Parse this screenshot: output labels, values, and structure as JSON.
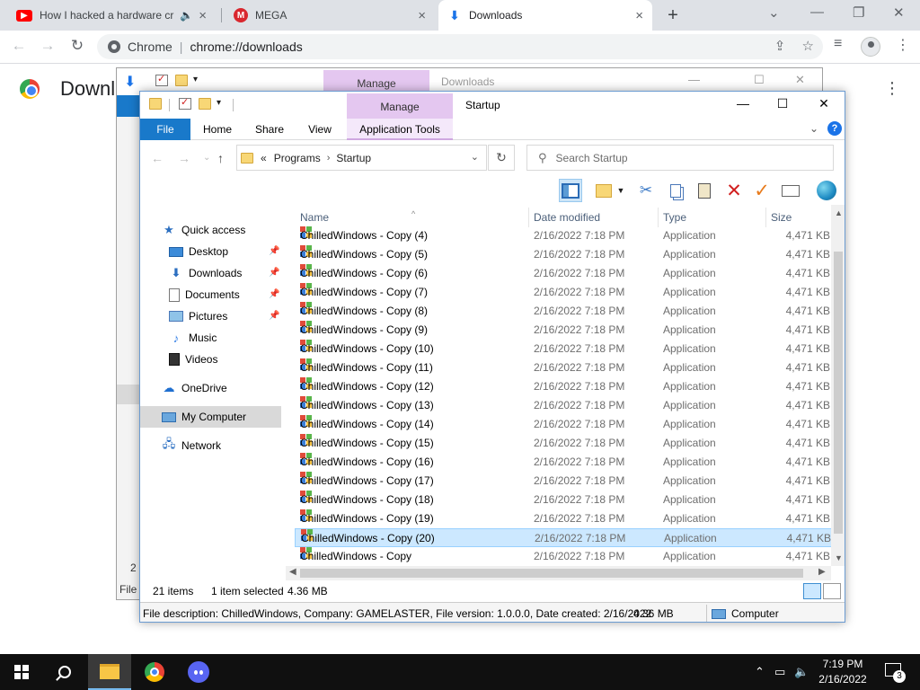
{
  "browser": {
    "tabs": [
      {
        "title": "How I hacked a hardware cr",
        "favicon": "youtube-icon",
        "audio": "speaker-icon"
      },
      {
        "title": "MEGA",
        "favicon": "mega-icon"
      },
      {
        "title": "Downloads",
        "favicon": "download-icon",
        "active": true
      }
    ],
    "omnibox": {
      "chip": "Chrome",
      "url": "chrome://downloads"
    },
    "page_title": "Downl"
  },
  "back_window": {
    "manage": "Manage",
    "title": "Downloads",
    "status_count": "2 i",
    "file_tab": "File"
  },
  "explorer": {
    "manage": "Manage",
    "title": "Startup",
    "ribbon_tabs": [
      "File",
      "Home",
      "Share",
      "View",
      "Application Tools"
    ],
    "breadcrumb_prefix": "«",
    "breadcrumb": [
      "Programs",
      "Startup"
    ],
    "search_placeholder": "Search Startup",
    "columns": {
      "name": "Name",
      "date": "Date modified",
      "type": "Type",
      "size": "Size"
    },
    "nav": {
      "quick_access": "Quick access",
      "desktop": "Desktop",
      "downloads": "Downloads",
      "documents": "Documents",
      "pictures": "Pictures",
      "music": "Music",
      "videos": "Videos",
      "onedrive": "OneDrive",
      "my_computer": "My Computer",
      "network": "Network"
    },
    "files": [
      {
        "name": "ChilledWindows - Copy (4)",
        "date": "2/16/2022 7:18 PM",
        "type": "Application",
        "size": "4,471 KB"
      },
      {
        "name": "ChilledWindows - Copy (5)",
        "date": "2/16/2022 7:18 PM",
        "type": "Application",
        "size": "4,471 KB"
      },
      {
        "name": "ChilledWindows - Copy (6)",
        "date": "2/16/2022 7:18 PM",
        "type": "Application",
        "size": "4,471 KB"
      },
      {
        "name": "ChilledWindows - Copy (7)",
        "date": "2/16/2022 7:18 PM",
        "type": "Application",
        "size": "4,471 KB"
      },
      {
        "name": "ChilledWindows - Copy (8)",
        "date": "2/16/2022 7:18 PM",
        "type": "Application",
        "size": "4,471 KB"
      },
      {
        "name": "ChilledWindows - Copy (9)",
        "date": "2/16/2022 7:18 PM",
        "type": "Application",
        "size": "4,471 KB"
      },
      {
        "name": "ChilledWindows - Copy (10)",
        "date": "2/16/2022 7:18 PM",
        "type": "Application",
        "size": "4,471 KB"
      },
      {
        "name": "ChilledWindows - Copy (11)",
        "date": "2/16/2022 7:18 PM",
        "type": "Application",
        "size": "4,471 KB"
      },
      {
        "name": "ChilledWindows - Copy (12)",
        "date": "2/16/2022 7:18 PM",
        "type": "Application",
        "size": "4,471 KB"
      },
      {
        "name": "ChilledWindows - Copy (13)",
        "date": "2/16/2022 7:18 PM",
        "type": "Application",
        "size": "4,471 KB"
      },
      {
        "name": "ChilledWindows - Copy (14)",
        "date": "2/16/2022 7:18 PM",
        "type": "Application",
        "size": "4,471 KB"
      },
      {
        "name": "ChilledWindows - Copy (15)",
        "date": "2/16/2022 7:18 PM",
        "type": "Application",
        "size": "4,471 KB"
      },
      {
        "name": "ChilledWindows - Copy (16)",
        "date": "2/16/2022 7:18 PM",
        "type": "Application",
        "size": "4,471 KB"
      },
      {
        "name": "ChilledWindows - Copy (17)",
        "date": "2/16/2022 7:18 PM",
        "type": "Application",
        "size": "4,471 KB"
      },
      {
        "name": "ChilledWindows - Copy (18)",
        "date": "2/16/2022 7:18 PM",
        "type": "Application",
        "size": "4,471 KB"
      },
      {
        "name": "ChilledWindows - Copy (19)",
        "date": "2/16/2022 7:18 PM",
        "type": "Application",
        "size": "4,471 KB"
      },
      {
        "name": "ChilledWindows - Copy (20)",
        "date": "2/16/2022 7:18 PM",
        "type": "Application",
        "size": "4,471 KB",
        "selected": true
      },
      {
        "name": "ChilledWindows - Copy",
        "date": "2/16/2022 7:18 PM",
        "type": "Application",
        "size": "4,471 KB"
      }
    ],
    "status": {
      "count": "21 items",
      "selected": "1 item selected",
      "size": "4.36 MB"
    },
    "description": {
      "text": "File description: ChilledWindows, Company: GAMELASTER, File version: 1.0.0.0, Date created: 2/16/2022",
      "size": "4.36 MB",
      "location": "Computer"
    }
  },
  "taskbar": {
    "time": "7:19 PM",
    "date": "2/16/2022",
    "notifications": "3"
  },
  "colors": {
    "accent": "#1979ca",
    "manage_tab": "#e4c7f0",
    "selection": "#cce8ff",
    "taskbar": "#101010"
  }
}
